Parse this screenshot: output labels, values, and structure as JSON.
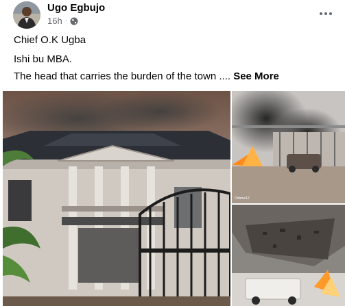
{
  "post": {
    "author": "Ugo Egbujo",
    "timestamp": "16h",
    "separator": "·",
    "privacy_icon": "globe-icon",
    "more_icon": "more-options-icon"
  },
  "body": {
    "line1": "Chief O.K Ugba",
    "line2": "Ishi bu MBA.",
    "line3": "The head that carries the burden of the town ....",
    "see_more": "See More"
  },
  "photos": {
    "watermark": "Odione12"
  },
  "colors": {
    "text_primary": "#050505",
    "text_secondary": "#65676b",
    "background": "#ffffff"
  }
}
